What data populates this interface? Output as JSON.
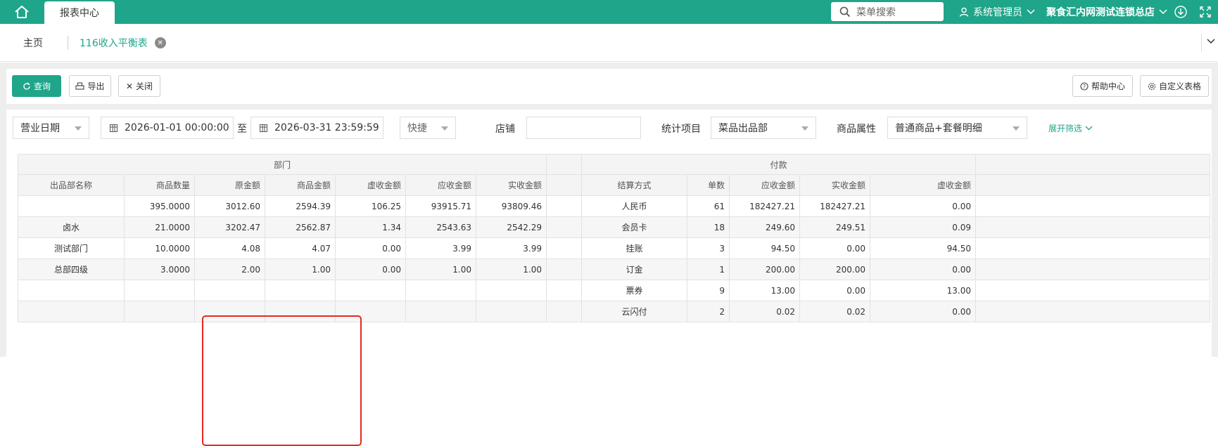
{
  "topbar": {
    "tab": "报表中心",
    "search_placeholder": "菜单搜索",
    "user": "系统管理员",
    "store": "聚食汇内网测试连锁总店",
    "icons": [
      "home-icon",
      "search-icon",
      "user-icon",
      "chevron-down-icon",
      "download-icon",
      "fullscreen-icon"
    ]
  },
  "breadcrumb": {
    "home": "主页",
    "current": "116收入平衡表"
  },
  "toolbar": {
    "query": "查询",
    "export": "导出",
    "close": "关闭",
    "help": "帮助中心",
    "custom": "自定义表格"
  },
  "filters": {
    "date_type": "营业日期",
    "start": "2026-01-01 00:00:00",
    "to": "至",
    "end": "2026-03-31 23:59:59",
    "quick": "快捷",
    "store_label": "店铺",
    "store_value": "",
    "stat_label": "统计项目",
    "stat_value": "菜品出品部",
    "attr_label": "商品属性",
    "attr_value": "普通商品+套餐明细",
    "expand": "展开筛选"
  },
  "table": {
    "group_dept": "部门",
    "group_pay": "付款",
    "dept_headers": [
      "出品部名称",
      "商品数量",
      "原金额",
      "商品金额",
      "虚收金额",
      "应收金额",
      "实收金额"
    ],
    "pay_headers": [
      "结算方式",
      "单数",
      "应收金额",
      "实收金额",
      "虚收金额"
    ],
    "dept_rows": [
      [
        "",
        "395.0000",
        "3012.60",
        "2594.39",
        "106.25",
        "93915.71",
        "93809.46"
      ],
      [
        "卤水",
        "21.0000",
        "3202.47",
        "2562.87",
        "1.34",
        "2543.63",
        "2542.29"
      ],
      [
        "测试部门",
        "10.0000",
        "4.08",
        "4.07",
        "0.00",
        "3.99",
        "3.99"
      ],
      [
        "总部四级",
        "3.0000",
        "2.00",
        "1.00",
        "0.00",
        "1.00",
        "1.00"
      ],
      [
        "",
        "",
        "",
        "",
        "",
        "",
        ""
      ],
      [
        "",
        "",
        "",
        "",
        "",
        "",
        ""
      ]
    ],
    "pay_rows": [
      [
        "人民币",
        "61",
        "182427.21",
        "182427.21",
        "0.00"
      ],
      [
        "会员卡",
        "18",
        "249.60",
        "249.51",
        "0.09"
      ],
      [
        "挂账",
        "3",
        "94.50",
        "0.00",
        "94.50"
      ],
      [
        "订金",
        "1",
        "200.00",
        "200.00",
        "0.00"
      ],
      [
        "票券",
        "9",
        "13.00",
        "0.00",
        "13.00"
      ],
      [
        "云闪付",
        "2",
        "0.02",
        "0.02",
        "0.00"
      ]
    ]
  },
  "colors": {
    "brand": "#1fa58a",
    "highlight": "#e8281e"
  }
}
